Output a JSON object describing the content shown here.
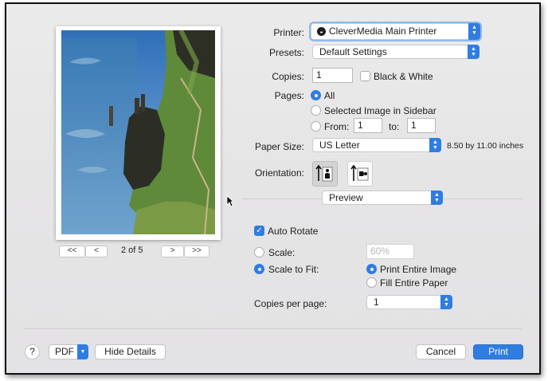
{
  "printer": {
    "label": "Printer:",
    "value": "CleverMedia Main Printer"
  },
  "presets": {
    "label": "Presets:",
    "value": "Default Settings"
  },
  "copies": {
    "label": "Copies:",
    "value": "1",
    "bw_label": "Black & White",
    "bw_checked": false
  },
  "pages": {
    "label": "Pages:",
    "all_label": "All",
    "selected_label": "Selected Image in Sidebar",
    "from_label": "From:",
    "from_value": "1",
    "to_label": "to:",
    "to_value": "1"
  },
  "paper": {
    "label": "Paper Size:",
    "value": "US Letter",
    "dimensions": "8.50 by 11.00 inches"
  },
  "orientation": {
    "label": "Orientation:",
    "selected": "portrait"
  },
  "section_popup": {
    "value": "Preview"
  },
  "auto_rotate": {
    "label": "Auto Rotate",
    "checked": true
  },
  "scale": {
    "label": "Scale:",
    "value": "60%"
  },
  "scale_to_fit": {
    "label": "Scale to Fit:",
    "print_entire_label": "Print Entire Image",
    "fill_entire_label": "Fill Entire Paper"
  },
  "copies_per_page": {
    "label": "Copies per page:",
    "value": "1"
  },
  "preview_nav": {
    "page_indicator": "2 of 5",
    "first": "<<",
    "prev": "<",
    "next": ">",
    "last": ">>"
  },
  "footer": {
    "help": "?",
    "pdf": "PDF",
    "hide_details": "Hide Details",
    "cancel": "Cancel",
    "print": "Print"
  },
  "colors": {
    "accent": "#2f7de1",
    "background": "#e6e5e6"
  }
}
